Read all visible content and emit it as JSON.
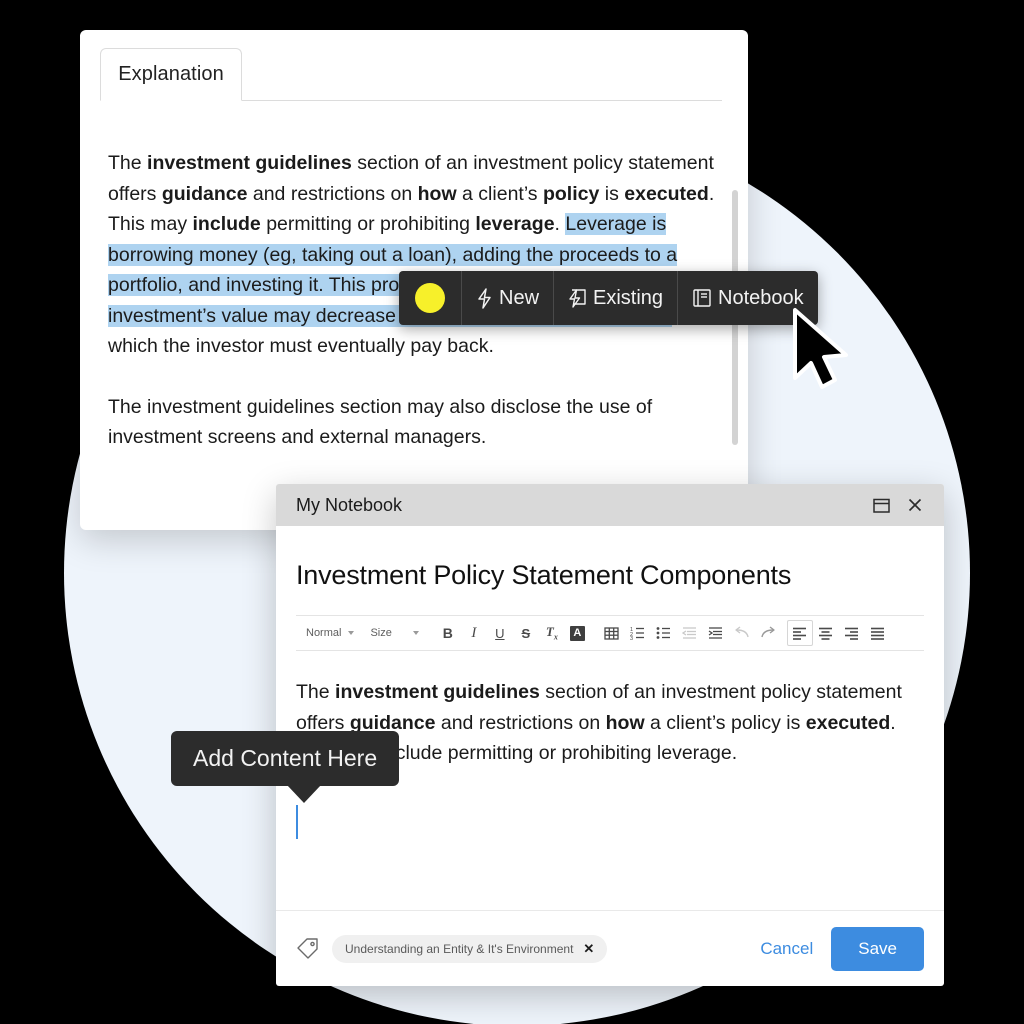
{
  "explanation_card": {
    "tab_label": "Explanation",
    "paragraph1": {
      "seg1": "The ",
      "bold1": "investment guidelines",
      "seg2": " section of an investment policy statement offers ",
      "bold2": "guidance",
      "seg3": " and restrictions on ",
      "bold3": "how",
      "seg4": " a client’s ",
      "bold4": "policy",
      "seg5": " is ",
      "bold5": "executed",
      "seg6": ".  This may ",
      "bold6": "include",
      "seg7": " permitting or prohibiting ",
      "bold7": "leverage",
      "seg8": ". ",
      "highlighted": "Leverage is borrowing money (eg, taking out a loan), adding the proceeds to a portfolio, and investing it.  This process creates risk since the investment’s value may decrease and become less than the loan,",
      "seg9": " which the investor must eventually pay back."
    },
    "paragraph2": "The investment guidelines section may also disclose the use of investment screens and external managers."
  },
  "highlight_toolbar": {
    "swatch_color": "#f7f02a",
    "items": [
      {
        "label": "New",
        "icon": "lightning-bolt-icon"
      },
      {
        "label": "Existing",
        "icon": "lightning-bolt-in-square-icon"
      },
      {
        "label": "Notebook",
        "icon": "book-icon"
      }
    ]
  },
  "notebook": {
    "window_title": "My Notebook",
    "window_buttons": [
      {
        "name": "restore-window-icon"
      },
      {
        "name": "close-icon"
      }
    ],
    "document_title": "Investment Policy Statement Components",
    "toolbar": {
      "style_dropdown": "Normal",
      "size_dropdown": "Size",
      "buttons": [
        {
          "name": "bold-button",
          "glyph": "B"
        },
        {
          "name": "italic-button",
          "glyph": "I"
        },
        {
          "name": "underline-button",
          "glyph": "U"
        },
        {
          "name": "strikethrough-button",
          "glyph": "S"
        },
        {
          "name": "clear-format-button",
          "glyph": "Tx"
        },
        {
          "name": "text-color-button",
          "glyph": "A"
        },
        {
          "name": "insert-table-button",
          "glyph": "table"
        },
        {
          "name": "ordered-list-button",
          "glyph": "ordered-list"
        },
        {
          "name": "bullet-list-button",
          "glyph": "bullet-list"
        },
        {
          "name": "outdent-button",
          "glyph": "outdent"
        },
        {
          "name": "indent-button",
          "glyph": "indent"
        },
        {
          "name": "undo-button",
          "glyph": "undo"
        },
        {
          "name": "redo-button",
          "glyph": "redo"
        },
        {
          "name": "align-left-button",
          "glyph": "align-left"
        },
        {
          "name": "align-center-button",
          "glyph": "align-center"
        },
        {
          "name": "align-right-button",
          "glyph": "align-right"
        },
        {
          "name": "align-justify-button",
          "glyph": "align-justify"
        }
      ]
    },
    "editor_body": {
      "seg1": "The ",
      "bold1": "investment guidelines",
      "seg2": " section of an investment policy statement offers ",
      "bold2": "guidance",
      "seg3": " and restrictions on ",
      "bold3": "how",
      "seg4": " a client’s policy is ",
      "bold4": "executed",
      "seg5": ".  This may include permitting or prohibiting leverage."
    },
    "tooltip": "Add Content Here",
    "footer": {
      "tag_icon": "tag-icon",
      "tag_label": "Understanding an Entity & It's Environment",
      "tag_remove": "✕",
      "cancel_label": "Cancel",
      "save_label": "Save",
      "save_color": "#3d8ce0"
    }
  }
}
